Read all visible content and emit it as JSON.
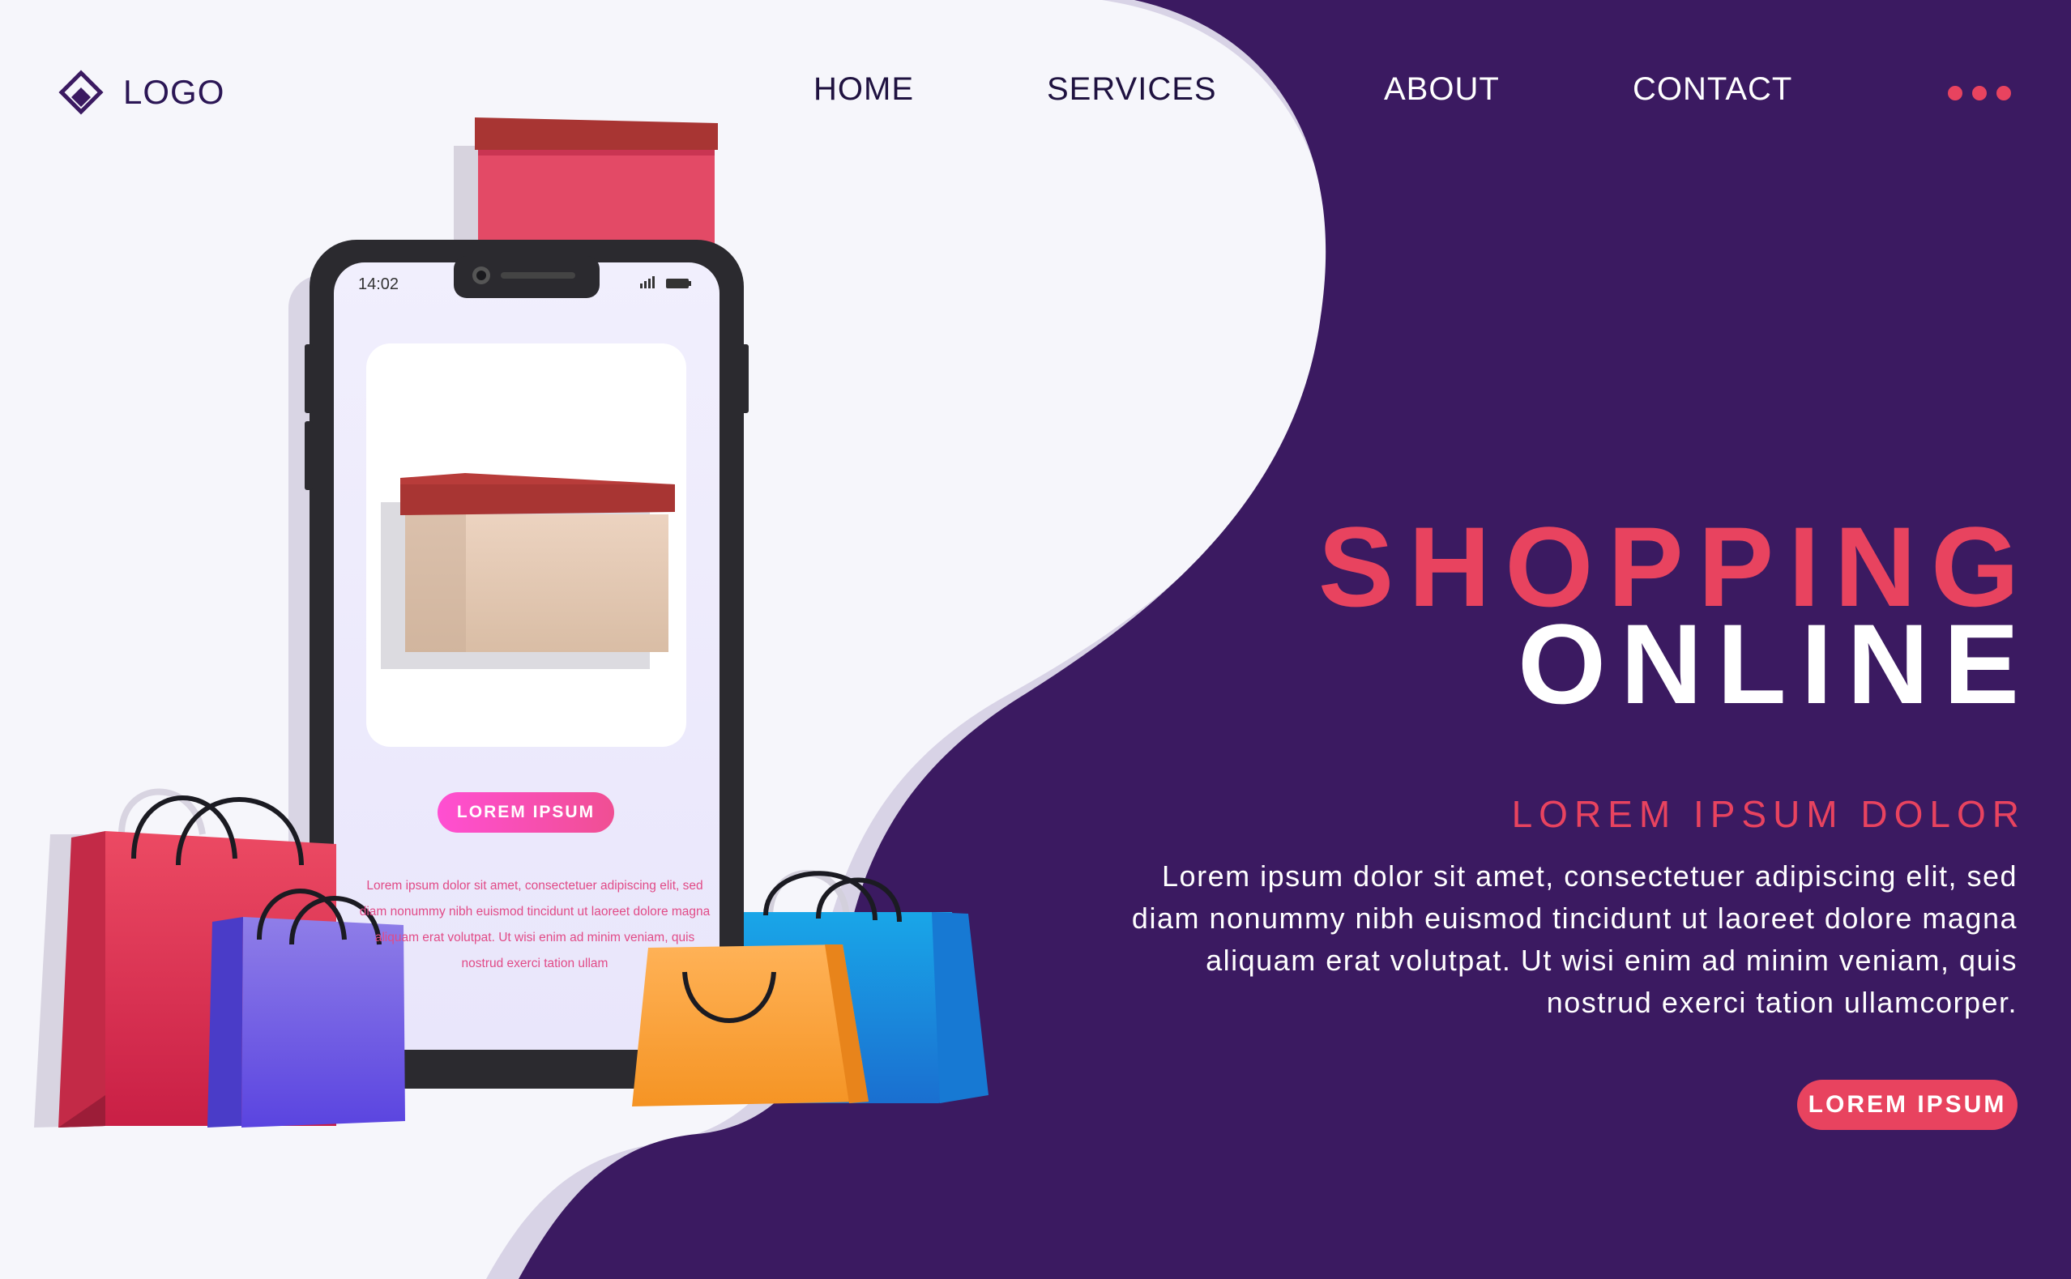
{
  "logo": {
    "text": "LOGO",
    "icon": "diamond-logo-icon"
  },
  "nav": {
    "home": "HOME",
    "services": "SERVICES",
    "about": "ABOUT",
    "contact": "CONTACT",
    "more_icon": "more-dots-icon"
  },
  "hero": {
    "title_line1": "SHOPPING",
    "title_line2": "ONLINE",
    "subtitle": "LOREM IPSUM DOLOR",
    "body": "Lorem ipsum dolor sit amet, consectetuer adipiscing elit, sed diam nonummy nibh euismod tincidunt ut laoreet dolore magna aliquam erat volutpat. Ut wisi enim ad minim veniam, quis nostrud exerci tation ullamcorper.",
    "cta_label": "LOREM IPSUM"
  },
  "phone": {
    "time": "14:02",
    "button_label": "LOREM IPSUM",
    "text": "Lorem ipsum dolor sit amet, consectetuer adipiscing elit, sed diam nonummy nibh euismod tincidunt ut laoreet dolore magna aliquam erat volutpat. Ut wisi enim ad minim veniam, quis nostrud exerci tation ullam"
  },
  "colors": {
    "purple": "#3b1a61",
    "accent": "#e8435f",
    "white": "#ffffff",
    "page_bg": "#f6f6fb"
  }
}
